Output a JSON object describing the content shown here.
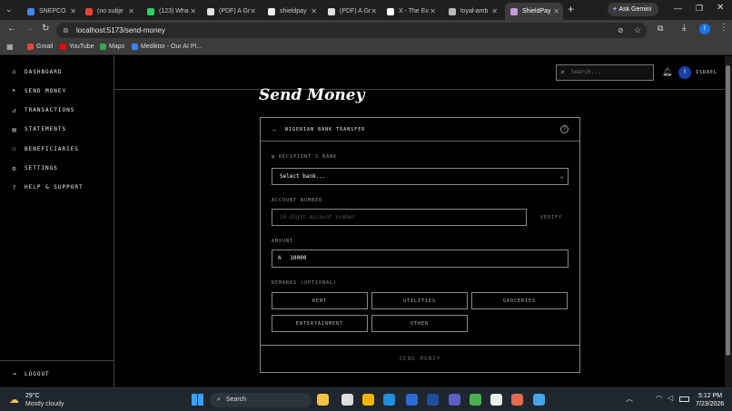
{
  "browser": {
    "tabs": [
      {
        "label": "SNEPCO",
        "color": "#4285f4"
      },
      {
        "label": "(no subje",
        "color": "#ea4335"
      },
      {
        "label": "(123) Wha",
        "color": "#25d366"
      },
      {
        "label": "(PDF) A Gr",
        "color": "#e0e0e0"
      },
      {
        "label": "shieldpay",
        "color": "#f0f0f0"
      },
      {
        "label": "(PDF) A Gr",
        "color": "#e0e0e0"
      },
      {
        "label": "X - The Ev",
        "color": "#ffffff"
      },
      {
        "label": "loyal-amb",
        "color": "#bbbbbb"
      },
      {
        "label": "ShieldPay",
        "color": "#c49bd8"
      }
    ],
    "ask_gemini": "Ask Gemini",
    "url": "localhost:5173/send-money",
    "profile_initial": "I",
    "bookmarks": [
      {
        "label": "Gmail",
        "color": "#ea4335"
      },
      {
        "label": "YouTube",
        "color": "#ff0000"
      },
      {
        "label": "Maps",
        "color": "#34a853"
      },
      {
        "label": "Mediktor - Our AI Pl...",
        "color": "#3b82f6"
      }
    ]
  },
  "sidebar": {
    "items": [
      {
        "label": "DASHBOARD",
        "icon": "home-icon"
      },
      {
        "label": "SEND MONEY",
        "icon": "send-icon"
      },
      {
        "label": "TRANSACTIONS",
        "icon": "history-icon"
      },
      {
        "label": "STATEMENTS",
        "icon": "document-icon"
      },
      {
        "label": "BENEFICIARIES",
        "icon": "users-icon"
      },
      {
        "label": "SETTINGS",
        "icon": "gear-icon"
      },
      {
        "label": "HELP & SUPPORT",
        "icon": "help-icon"
      }
    ],
    "logout": "LOGOUT"
  },
  "header": {
    "search_placeholder": "Search...",
    "user_initial": "I",
    "user_name": "ISRAEL"
  },
  "main": {
    "title": "Send Money",
    "card_title": "NIGERIAN BANK TRANSFER",
    "recipient_label": "RECIPIENT'S BANK",
    "bank_select": "Select bank...",
    "account_label": "ACCOUNT NUMBER",
    "account_placeholder": "10-digit account number",
    "verify": "VERIFY",
    "amount_label": "AMOUNT",
    "currency_symbol": "₦",
    "amount_value": "10000",
    "remarks_label": "REMARKS (OPTIONAL)",
    "remarks": [
      "RENT",
      "UTILITIES",
      "GROCERIES",
      "ENTERTAINMENT",
      "OTHER"
    ],
    "submit": "SEND MONEY"
  },
  "taskbar": {
    "temperature": "29°C",
    "weather": "Mostly cloudy",
    "search": "Search",
    "time": "5:12 PM",
    "date": "7/23/2026"
  }
}
